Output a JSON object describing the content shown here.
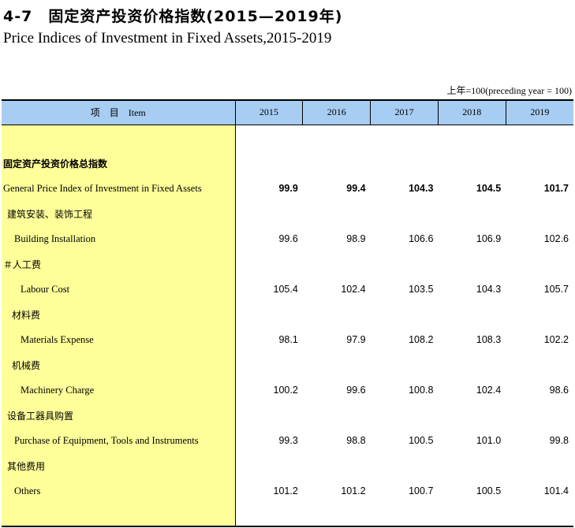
{
  "title_cn": "4-7　固定资产投资价格指数(2015—2019年)",
  "title_en": "Price Indices of Investment in Fixed Assets,2015-2019",
  "unit_note": "上年=100(preceding year = 100)",
  "header": {
    "item": "项　目　Item",
    "years": [
      "2015",
      "2016",
      "2017",
      "2018",
      "2019"
    ]
  },
  "rows": [
    {
      "label": "固定资产投资价格总指数",
      "values": null
    },
    {
      "label": "General Price Index of Investment in Fixed Assets",
      "values": [
        "99.9",
        "99.4",
        "104.3",
        "104.5",
        "101.7"
      ]
    },
    {
      "label": "建筑安装、装饰工程",
      "values": null
    },
    {
      "label": "Building Installation",
      "values": [
        "99.6",
        "98.9",
        "106.6",
        "106.9",
        "102.6"
      ]
    },
    {
      "label": "＃人工费",
      "values": null
    },
    {
      "label": "Labour Cost",
      "values": [
        "105.4",
        "102.4",
        "103.5",
        "104.3",
        "105.7"
      ]
    },
    {
      "label": "材料费",
      "values": null
    },
    {
      "label": "Materials Expense",
      "values": [
        "98.1",
        "97.9",
        "108.2",
        "108.3",
        "102.2"
      ]
    },
    {
      "label": "机械费",
      "values": null
    },
    {
      "label": "Machinery Charge",
      "values": [
        "100.2",
        "99.6",
        "100.8",
        "102.4",
        "98.6"
      ]
    },
    {
      "label": "设备工器具购置",
      "values": null
    },
    {
      "label": "Purchase of Equipment, Tools and Instruments",
      "values": [
        "99.3",
        "98.8",
        "100.5",
        "101.0",
        "99.8"
      ]
    },
    {
      "label": "其他费用",
      "values": null
    },
    {
      "label": "Others",
      "values": [
        "101.2",
        "101.2",
        "100.7",
        "100.5",
        "101.4"
      ]
    }
  ]
}
